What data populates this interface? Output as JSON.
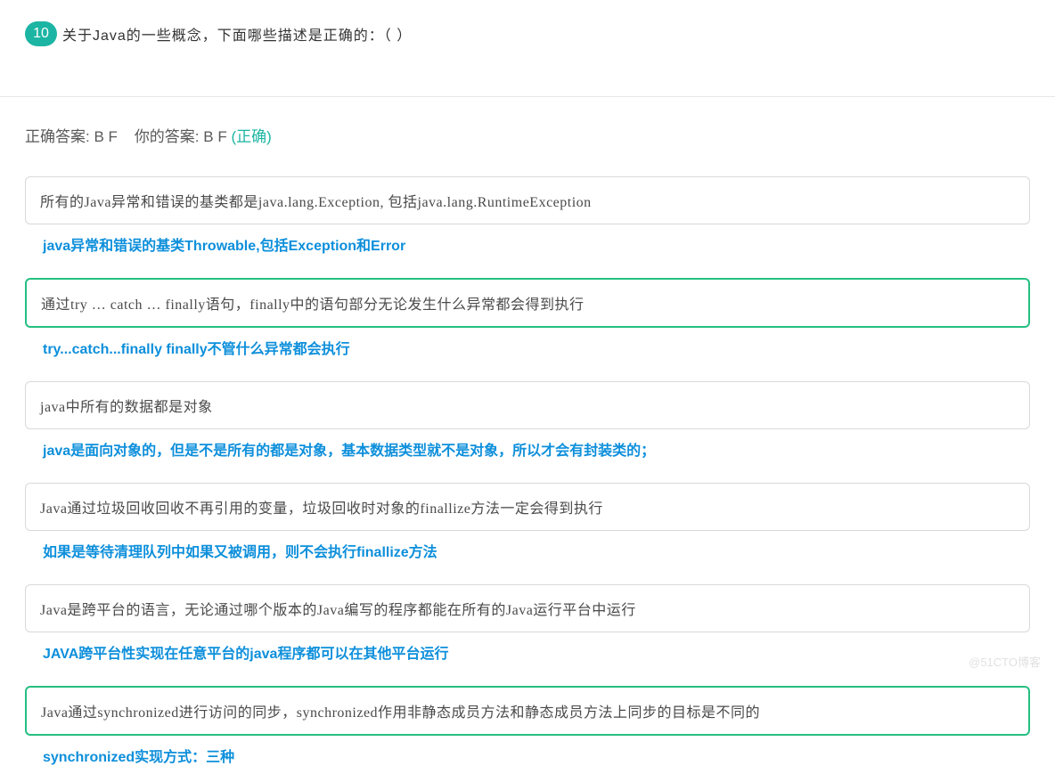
{
  "question": {
    "number": "10",
    "text": "关于Java的一些概念，下面哪些描述是正确的：（    ）"
  },
  "answer_line": {
    "correct_label": "正确答案: B F",
    "your_label": "你的答案: B F",
    "status": "(正确)"
  },
  "options": [
    {
      "text": "所有的Java异常和错误的基类都是java.lang.Exception, 包括java.lang.RuntimeException",
      "correct": false,
      "explain": "java异常和错误的基类Throwable,包括Exception和Error"
    },
    {
      "text": "通过try … catch … finally语句，finally中的语句部分无论发生什么异常都会得到执行",
      "correct": true,
      "explain": "try...catch...finally finally不管什么异常都会执行"
    },
    {
      "text": "java中所有的数据都是对象",
      "correct": false,
      "explain": "java是面向对象的，但是不是所有的都是对象，基本数据类型就不是对象，所以才会有封装类的；"
    },
    {
      "text": "Java通过垃圾回收回收不再引用的变量，垃圾回收时对象的finallize方法一定会得到执行",
      "correct": false,
      "explain": "如果是等待清理队列中如果又被调用，则不会执行finallize方法"
    },
    {
      "text": "Java是跨平台的语言，无论通过哪个版本的Java编写的程序都能在所有的Java运行平台中运行",
      "correct": false,
      "explain": "JAVA跨平台性实现在任意平台的java程序都可以在其他平台运行"
    },
    {
      "text": "Java通过synchronized进行访问的同步，synchronized作用非静态成员方法和静态成员方法上同步的目标是不同的",
      "correct": true,
      "explain": "synchronized实现方式：三种"
    }
  ],
  "watermark": "@51CTO博客"
}
